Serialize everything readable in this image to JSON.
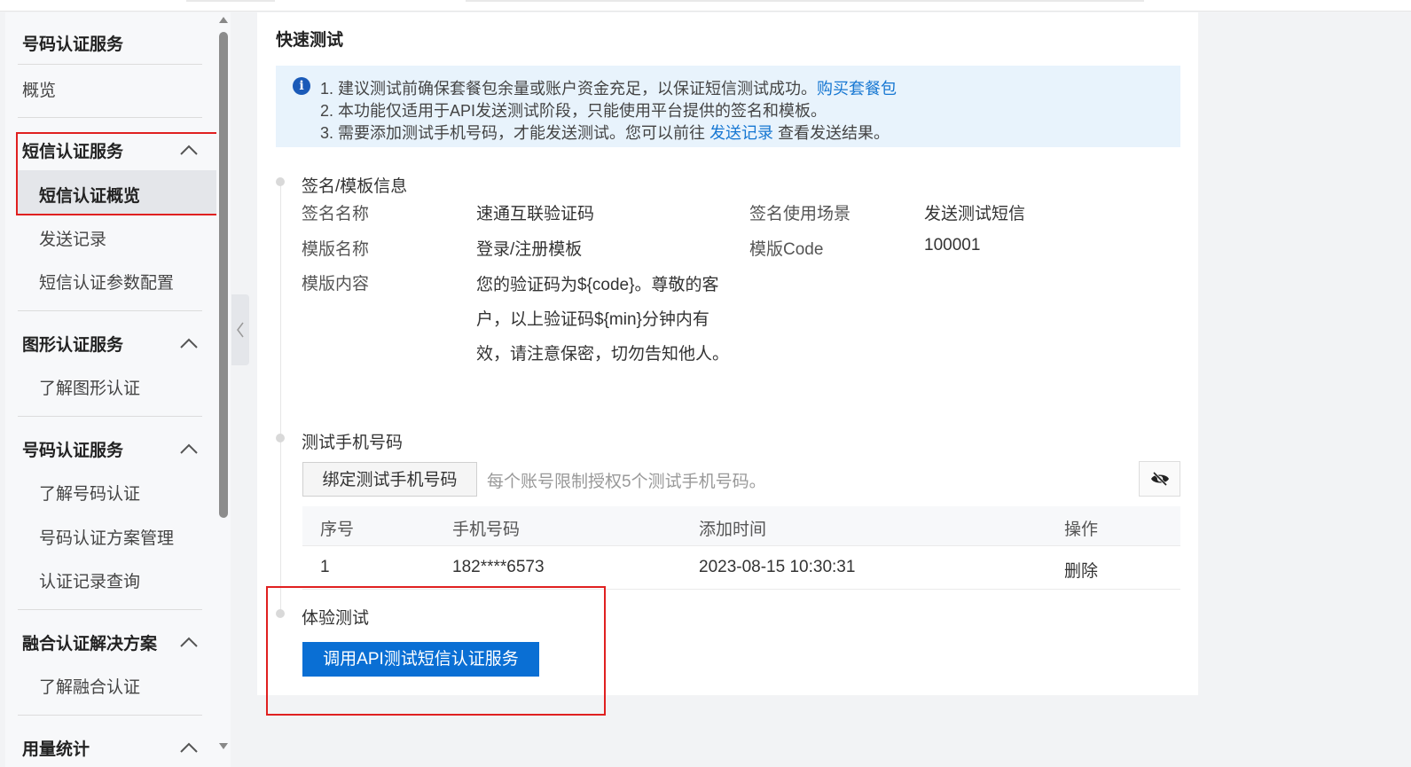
{
  "sidebar": {
    "top_title": "号码认证服务",
    "overview": "概览",
    "groups": [
      {
        "title": "短信认证服务",
        "items": [
          "短信认证概览",
          "发送记录",
          "短信认证参数配置"
        ]
      },
      {
        "title": "图形认证服务",
        "items": [
          "了解图形认证"
        ]
      },
      {
        "title": "号码认证服务",
        "items": [
          "了解号码认证",
          "号码认证方案管理",
          "认证记录查询"
        ]
      },
      {
        "title": "融合认证解决方案",
        "items": [
          "了解融合认证"
        ]
      },
      {
        "title": "用量统计",
        "items": []
      }
    ],
    "active_item": "短信认证概览"
  },
  "main": {
    "title": "快速测试",
    "notice": {
      "line1_text": "1. 建议测试前确保套餐包余量或账户资金充足，以保证短信测试成功。",
      "line1_link": "购买套餐包",
      "line2_text": "2. 本功能仅适用于API发送测试阶段，只能使用平台提供的签名和模板。",
      "line3_text": "3. 需要添加测试手机号码，才能发送测试。您可以前往 ",
      "line3_link": "发送记录",
      "line3_suffix": " 查看发送结果。"
    },
    "sign_section": {
      "title": "签名/模板信息",
      "sign_name_label": "签名名称",
      "sign_name_value": "速通互联验证码",
      "scene_label": "签名使用场景",
      "scene_value": "发送测试短信",
      "template_name_label": "模版名称",
      "template_name_value": "登录/注册模板",
      "template_code_label": "模版Code",
      "template_code_value": "100001",
      "template_content_label": "模版内容",
      "template_content_value": "您的验证码为${code}。尊敬的客户，以上验证码${min}分钟内有效，请注意保密，切勿告知他人。"
    },
    "phone_section": {
      "title": "测试手机号码",
      "bind_button": "绑定测试手机号码",
      "hint": "每个账号限制授权5个测试手机号码。",
      "table": {
        "headers": [
          "序号",
          "手机号码",
          "添加时间",
          "操作"
        ],
        "rows": [
          {
            "index": "1",
            "phone": "182****6573",
            "time": "2023-08-15 10:30:31",
            "action": "删除"
          }
        ]
      }
    },
    "trial_section": {
      "title": "体验测试",
      "button": "调用API测试短信认证服务"
    }
  },
  "colors": {
    "primary": "#0a6fd4",
    "link": "#1677d2",
    "notice_bg": "#e8f3fc",
    "highlight_box": "#e02020"
  }
}
